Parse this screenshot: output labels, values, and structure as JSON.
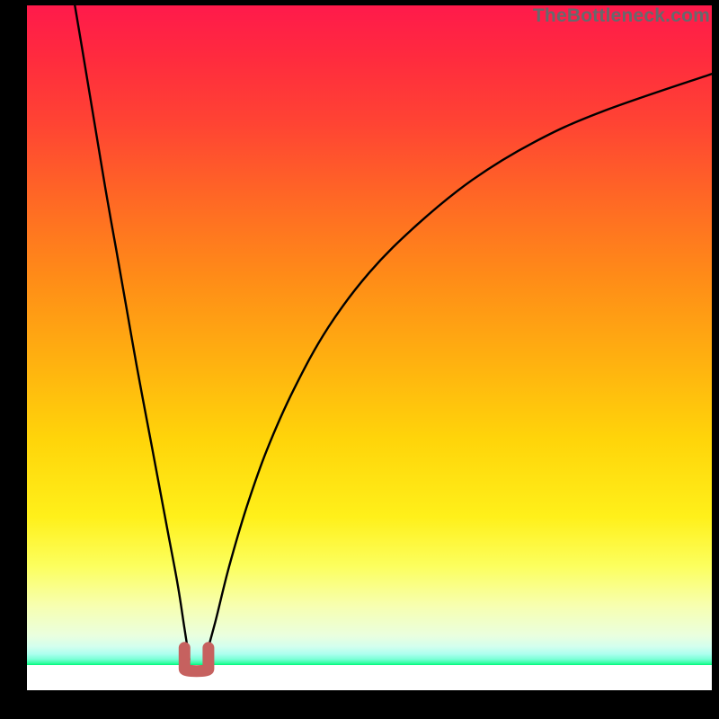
{
  "watermark": {
    "text": "TheBottleneck.com"
  },
  "colors": {
    "curve_stroke": "#000000",
    "marker_fill": "#c6615f",
    "background": "#000000",
    "gradient_top": "#ff1a4b",
    "gradient_bottom": "#00f679"
  },
  "chart_data": {
    "type": "line",
    "title": "",
    "xlabel": "",
    "ylabel": "",
    "xlim": [
      0,
      100
    ],
    "ylim": [
      0,
      100
    ],
    "note": "Two asymmetric descending curves meeting near x≈24, y≈3; U-shaped marker at the minimum.",
    "series": [
      {
        "name": "left-curve",
        "x": [
          7.0,
          8.5,
          10.0,
          11.5,
          13.0,
          14.5,
          16.0,
          17.5,
          19.0,
          20.5,
          22.0,
          23.0,
          23.7
        ],
        "values": [
          100,
          91,
          82,
          73,
          64.5,
          56,
          47.5,
          39.5,
          31.5,
          23.5,
          15.5,
          9.0,
          4.5
        ]
      },
      {
        "name": "right-curve",
        "x": [
          26.0,
          27.5,
          29.5,
          32.0,
          35.0,
          39.0,
          44.0,
          50.0,
          57.0,
          65.0,
          74.0,
          84.0,
          100.0
        ],
        "values": [
          4.5,
          10.0,
          18.0,
          26.5,
          35.0,
          44.0,
          53.0,
          61.0,
          68.0,
          74.5,
          80.0,
          84.5,
          90.0
        ]
      }
    ],
    "marker": {
      "name": "minimum-u-marker",
      "x_range": [
        23.0,
        26.5
      ],
      "y_range": [
        2.8,
        6.2
      ]
    }
  }
}
